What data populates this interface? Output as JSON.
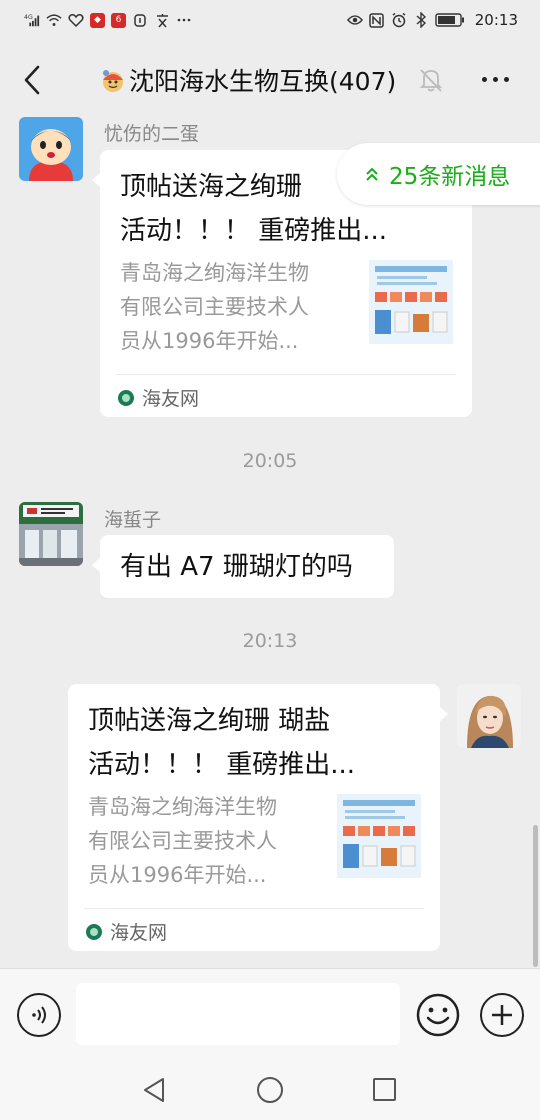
{
  "status_bar": {
    "network": "4G",
    "time": "20:13",
    "icons": [
      "signal-icon",
      "wifi-icon",
      "heart-app-icon",
      "app-badge-icon",
      "app-badge-icon",
      "gesture-icon",
      "translate-icon",
      "more-notifications-icon",
      "eye-icon",
      "nfc-icon",
      "alarm-icon",
      "bluetooth-icon",
      "battery-icon"
    ]
  },
  "header": {
    "title": "沈阳海水生物互换(407)"
  },
  "new_messages": {
    "label": "25条新消息"
  },
  "messages": [
    {
      "sender": "忧伤的二蛋",
      "card": {
        "title_line1": "顶帖送海之绚珊",
        "title_line2": "活动！！！ 重磅推出...",
        "desc_line1": "青岛海之绚海洋生物",
        "desc_line2": "有限公司主要技术人",
        "desc_line3": "员从1996年开始...",
        "source": "海友网"
      }
    },
    {
      "timestamp": "20:05"
    },
    {
      "sender": "海蜇子",
      "text": "有出 A7 珊瑚灯的吗"
    },
    {
      "timestamp": "20:13"
    },
    {
      "sender": "self",
      "card": {
        "title_line1": "顶帖送海之绚珊 瑚盐",
        "title_line2": "活动！！！ 重磅推出...",
        "desc_line1": "青岛海之绚海洋生物",
        "desc_line2": "有限公司主要技术人",
        "desc_line3": "员从1996年开始...",
        "source": "海友网"
      }
    }
  ],
  "input_bar": {
    "value": "",
    "placeholder": ""
  },
  "colors": {
    "background": "#ededed",
    "bubble": "#ffffff",
    "accent_green": "#1aad19",
    "meta_text": "#9b9b9b"
  }
}
